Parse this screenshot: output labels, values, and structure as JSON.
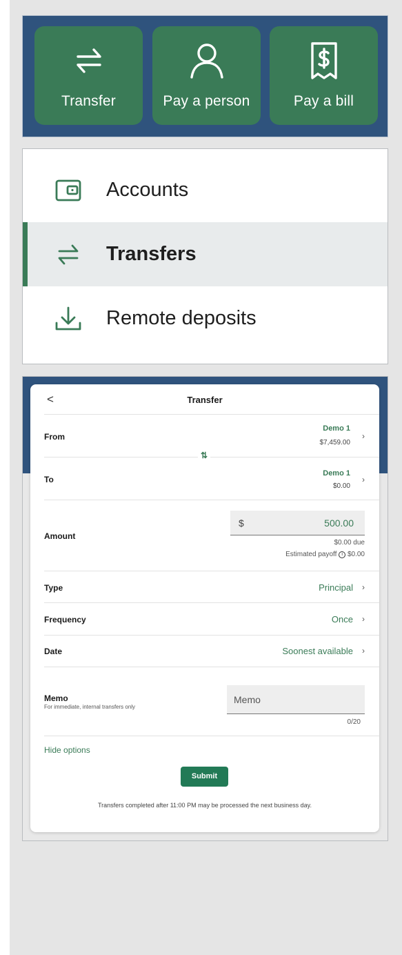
{
  "quick_actions": [
    {
      "label": "Transfer",
      "icon": "transfer-arrows-icon"
    },
    {
      "label": "Pay a person",
      "icon": "person-icon"
    },
    {
      "label": "Pay a bill",
      "icon": "bill-dollar-icon"
    }
  ],
  "nav": {
    "items": [
      {
        "label": "Accounts",
        "icon": "wallet-icon",
        "active": false
      },
      {
        "label": "Transfers",
        "icon": "transfer-arrows-icon",
        "active": true
      },
      {
        "label": "Remote deposits",
        "icon": "download-tray-icon",
        "active": false
      }
    ]
  },
  "transfer": {
    "title": "Transfer",
    "back_icon": "<",
    "from": {
      "label": "From",
      "account": "Demo 1",
      "balance": "$7,459.00"
    },
    "swap_icon": "⇅",
    "to": {
      "label": "To",
      "account": "Demo 1",
      "balance": "$0.00"
    },
    "amount": {
      "label": "Amount",
      "currency": "$",
      "value": "500.00",
      "due": "$0.00 due",
      "payoff_label": "Estimated payoff",
      "payoff_value": "$0.00"
    },
    "type": {
      "label": "Type",
      "value": "Principal"
    },
    "frequency": {
      "label": "Frequency",
      "value": "Once"
    },
    "date": {
      "label": "Date",
      "value": "Soonest available"
    },
    "memo": {
      "label": "Memo",
      "hint": "For immediate, internal transfers only",
      "placeholder": "Memo",
      "counter": "0/20"
    },
    "hide_options": "Hide options",
    "submit": "Submit",
    "note": "Transfers completed after 11:00 PM may be processed the next business day."
  },
  "colors": {
    "brand_blue": "#2f537d",
    "brand_green": "#3a7b57",
    "submit_green": "#227a56"
  }
}
